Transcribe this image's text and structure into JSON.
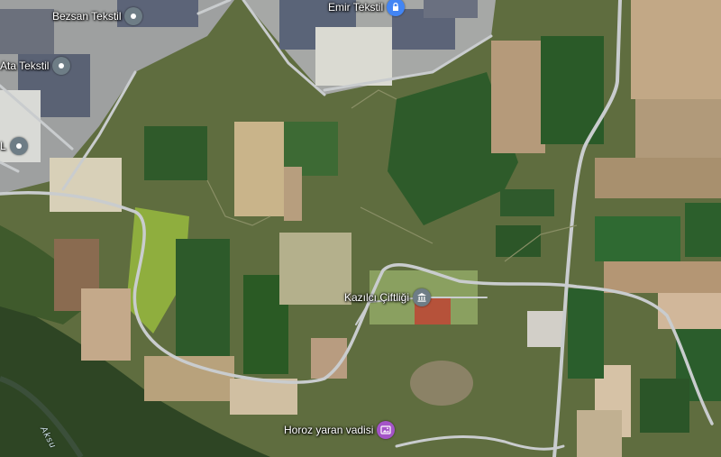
{
  "map": {
    "view": "satellite",
    "colors": {
      "pin_default": "#6e7d86",
      "pin_service": "#4285f4",
      "pin_landmark": "#6e7d86",
      "pin_nature": "#a454c8",
      "road": "#c9ccce"
    },
    "places": [
      {
        "name": "Bezsan Tekstil",
        "icon": "location-pin-icon",
        "type": "default"
      },
      {
        "name": "Emir Tekstil",
        "icon": "lock-icon",
        "type": "service"
      },
      {
        "name": "Ata Tekstil",
        "icon": "location-pin-icon",
        "type": "default"
      },
      {
        "name": "L",
        "icon": "location-pin-icon",
        "type": "default"
      },
      {
        "name": "Kazılcı Çiftliği",
        "icon": "landmark-icon",
        "type": "landmark"
      },
      {
        "name": "Horoz yaran vadisi",
        "icon": "photo-icon",
        "type": "nature"
      }
    ],
    "water_label": "Aksu"
  }
}
